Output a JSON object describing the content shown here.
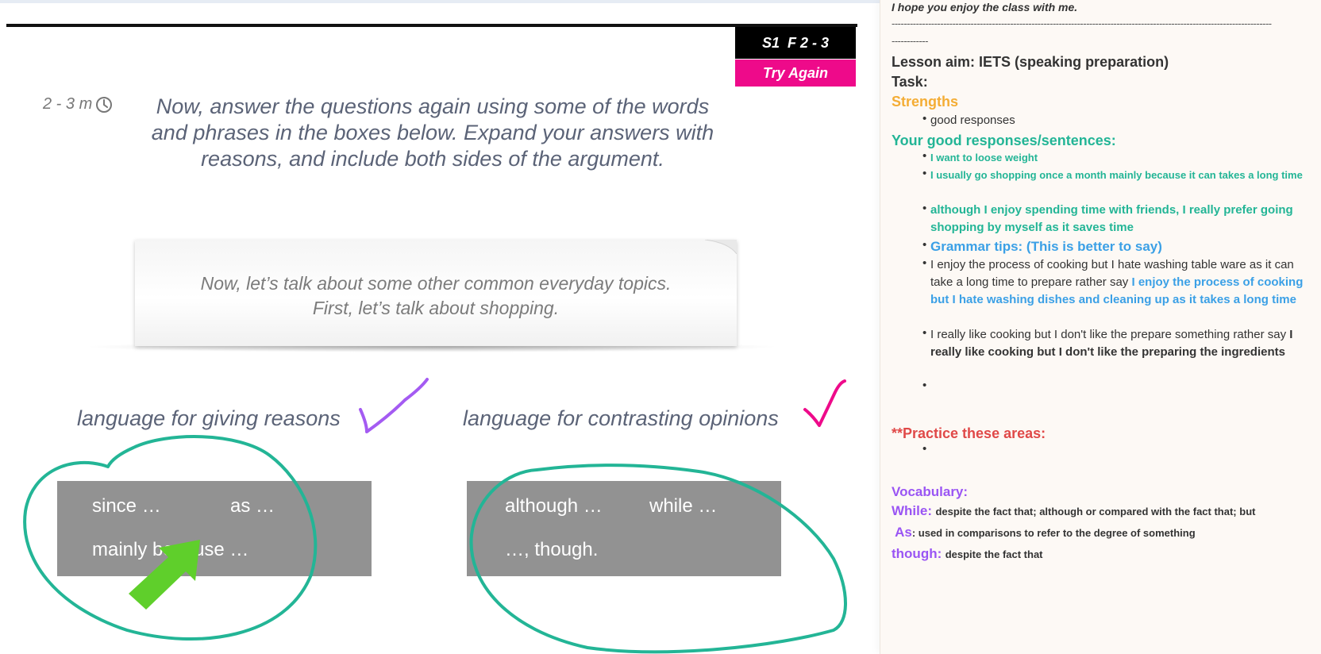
{
  "slide": {
    "code": "S1  F 2 - 3",
    "try_again": "Try Again",
    "timer": "2 - 3 m",
    "instruction": [
      "Now, answer the questions again using some of the words",
      "and phrases in the boxes below. Expand your answers with",
      "reasons, and include both sides of the argument."
    ],
    "note": [
      "Now, let’s talk about some other common everyday topics.",
      "First, let’s talk about shopping."
    ],
    "left_heading": "language for giving reasons",
    "right_heading": "language for contrasting opinions",
    "reasons": [
      "since …",
      "as …",
      "mainly because …"
    ],
    "contrasts": [
      "although …",
      "while …",
      "…, though."
    ],
    "annotation_colors": {
      "circle": "#23b596",
      "check_left": "#a45bf2",
      "check_right": "#ee0a8a",
      "arrow": "#5fcf2b"
    }
  },
  "notes": {
    "greeting": "I hope you enjoy the class with me.",
    "separator_1": "-----------------------------------------------------------------------------------------------------------------------------",
    "separator_2": "------------",
    "aim": "Lesson aim: IETS (speaking preparation)",
    "task": "Task:",
    "strengths_heading": "Strengths",
    "strengths": [
      "good responses"
    ],
    "good_heading": "Your good responses/sentences:",
    "good_1": "I want to loose weight",
    "good_2": "I usually go shopping once a month mainly because it can takes a long time",
    "good_3": "although I enjoy spending time with friends, I really prefer going shopping by myself as it saves time",
    "grammar_heading": "Grammar tips: (This is better to say)",
    "tip1_plain": "I enjoy the process of cooking but I hate washing table ware as it can take a long time to prepare rather say ",
    "tip1_better": "I enjoy the process of cooking but I hate washing dishes and cleaning up as it takes a long time",
    "tip2_plain": "I really like cooking but I don't like the prepare something rather say ",
    "tip2_better": "I really like cooking but I don't like the preparing  the ingredients",
    "practice_heading": "**Practice these areas:",
    "vocab_heading": "Vocabulary:",
    "vocab": [
      {
        "word": "While:",
        "def": "despite the fact that; although or compared with the fact that; but"
      },
      {
        "word": " As",
        "def": ": used in comparisons to refer to the degree of something"
      },
      {
        "word": "though:",
        "def": "despite the fact that"
      }
    ]
  }
}
